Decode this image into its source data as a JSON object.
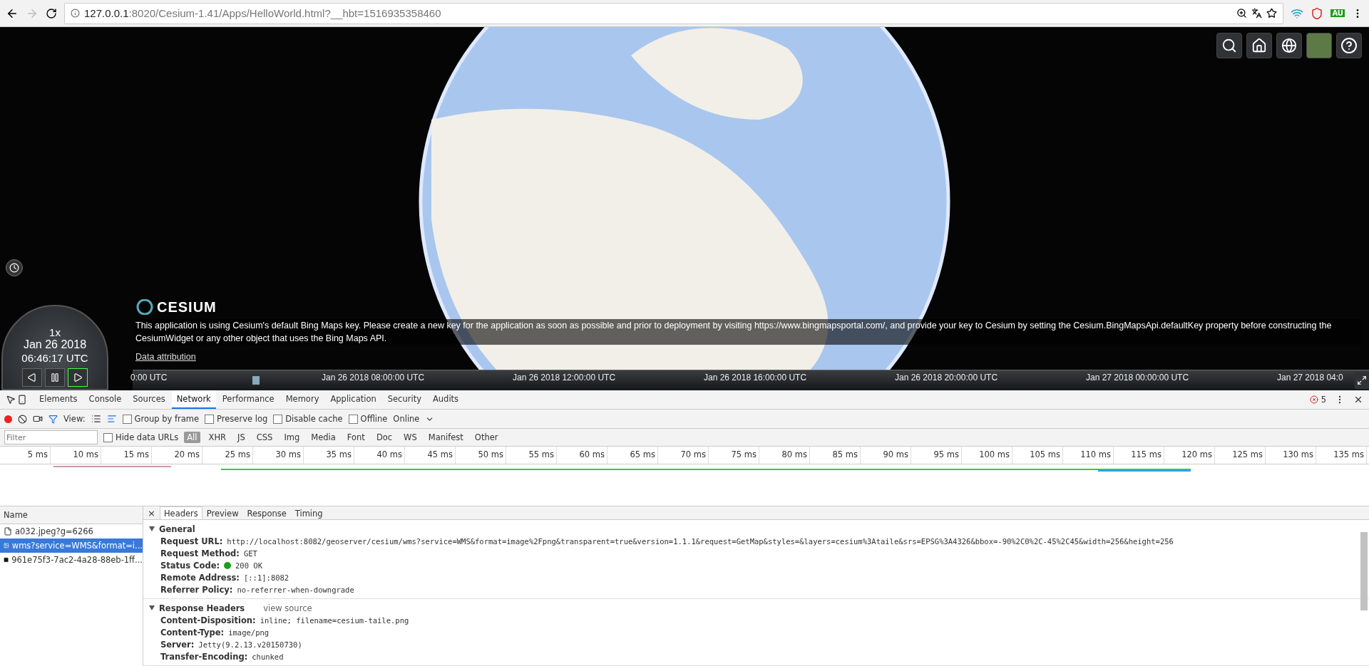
{
  "browser": {
    "url_host": "127.0.0.1",
    "url_path": ":8020/Cesium-1.41/Apps/HelloWorld.html?__hbt=1516935358460",
    "extension_badge": "AU"
  },
  "viewer": {
    "clock": {
      "speed": "1x",
      "date": "Jan 26 2018",
      "time": "06:46:17 UTC",
      "playing": true
    },
    "logo": "CESIUM",
    "credit": "This application is using Cesium's default Bing Maps key. Please create a new key for the application as soon as possible and prior to deployment by visiting https://www.bingmapsportal.com/, and provide your key to Cesium by setting the Cesium.BingMapsApi.defaultKey property before constructing the CesiumWidget or any other object that uses the Bing Maps API.",
    "credit_link": "Data attribution",
    "timeline_labels": [
      "0:00 UTC",
      "Jan 26 2018 08:00:00 UTC",
      "Jan 26 2018 12:00:00 UTC",
      "Jan 26 2018 16:00:00 UTC",
      "Jan 26 2018 20:00:00 UTC",
      "Jan 27 2018 00:00:00 UTC",
      "Jan 27 2018 04:0"
    ]
  },
  "devtools": {
    "tabs": [
      {
        "label": "Elements",
        "selected": false
      },
      {
        "label": "Console",
        "selected": false
      },
      {
        "label": "Sources",
        "selected": false
      },
      {
        "label": "Network",
        "selected": true
      },
      {
        "label": "Performance",
        "selected": false
      },
      {
        "label": "Memory",
        "selected": false
      },
      {
        "label": "Application",
        "selected": false
      },
      {
        "label": "Security",
        "selected": false
      },
      {
        "label": "Audits",
        "selected": false
      }
    ],
    "error_count": "5",
    "toolbar": {
      "recording": true,
      "view_label": "View:",
      "options": [
        {
          "label": "Group by frame",
          "checked": false
        },
        {
          "label": "Preserve log",
          "checked": false
        },
        {
          "label": "Disable cache",
          "checked": false
        },
        {
          "label": "Offline",
          "checked": false
        }
      ],
      "throttling": "Online"
    },
    "filter": {
      "placeholder": "Filter",
      "hide_data_urls": {
        "label": "Hide data URLs",
        "checked": false
      },
      "types": [
        {
          "label": "All",
          "selected": true
        },
        {
          "label": "XHR",
          "selected": false
        },
        {
          "label": "JS",
          "selected": false
        },
        {
          "label": "CSS",
          "selected": false
        },
        {
          "label": "Img",
          "selected": false
        },
        {
          "label": "Media",
          "selected": false
        },
        {
          "label": "Font",
          "selected": false
        },
        {
          "label": "Doc",
          "selected": false
        },
        {
          "label": "WS",
          "selected": false
        },
        {
          "label": "Manifest",
          "selected": false
        },
        {
          "label": "Other",
          "selected": false
        }
      ]
    },
    "ruler": [
      "5 ms",
      "10 ms",
      "15 ms",
      "20 ms",
      "25 ms",
      "30 ms",
      "35 ms",
      "40 ms",
      "45 ms",
      "50 ms",
      "55 ms",
      "60 ms",
      "65 ms",
      "70 ms",
      "75 ms",
      "80 ms",
      "85 ms",
      "90 ms",
      "95 ms",
      "100 ms",
      "105 ms",
      "110 ms",
      "115 ms",
      "120 ms",
      "125 ms",
      "130 ms",
      "135 ms"
    ],
    "requests": {
      "header": "Name",
      "rows": [
        {
          "name": "a032.jpeg?g=6266",
          "kind": "file",
          "selected": false
        },
        {
          "name": "wms?service=WMS&format=i...",
          "kind": "image",
          "selected": true
        },
        {
          "name": "961e75f3-7ac2-4a28-88eb-1ff...",
          "kind": "dark",
          "selected": false
        }
      ]
    },
    "detail": {
      "close": "×",
      "tabs": [
        {
          "label": "Headers",
          "selected": true
        },
        {
          "label": "Preview",
          "selected": false
        },
        {
          "label": "Response",
          "selected": false
        },
        {
          "label": "Timing",
          "selected": false
        }
      ],
      "sections": [
        {
          "title": "General",
          "expanded": true,
          "fields": [
            {
              "key": "Request URL:",
              "value": "http://localhost:8082/geoserver/cesium/wms?service=WMS&format=image%2Fpng&transparent=true&version=1.1.1&request=GetMap&styles=&layers=cesium%3Ataile&srs=EPSG%3A4326&bbox=-90%2C0%2C-45%2C45&width=256&height=256"
            },
            {
              "key": "Request Method:",
              "value": "GET"
            },
            {
              "key": "Status Code:",
              "value": "200 OK",
              "color": "#1aa01a"
            },
            {
              "key": "Remote Address:",
              "value": "[::1]:8082"
            },
            {
              "key": "Referrer Policy:",
              "value": "no-referrer-when-downgrade"
            }
          ]
        },
        {
          "title": "Response Headers",
          "expanded": true,
          "link": "view source",
          "fields": [
            {
              "key": "Content-Disposition:",
              "value": "inline; filename=cesium-taile.png"
            },
            {
              "key": "Content-Type:",
              "value": "image/png"
            },
            {
              "key": "Server:",
              "value": "Jetty(9.2.13.v20150730)"
            },
            {
              "key": "Transfer-Encoding:",
              "value": "chunked"
            }
          ]
        }
      ]
    }
  }
}
